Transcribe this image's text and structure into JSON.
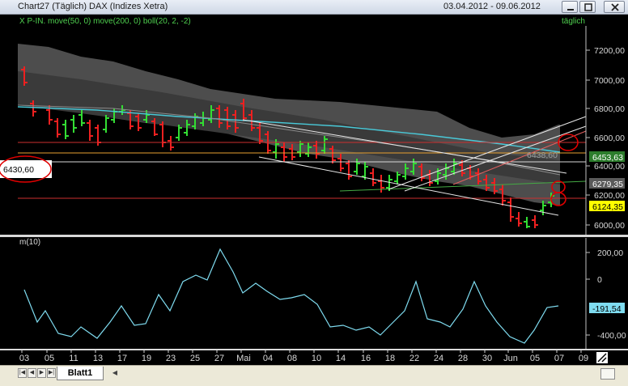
{
  "window": {
    "title": "Chart27 (Täglich)  DAX (Indizes Xetra)",
    "date_range": "03.04.2012 - 09.06.2012"
  },
  "indicator_line": "X P-IN. move(50, 0) move(200, 0) boll(20, 2, -2)",
  "period_label": "täglich",
  "lower_panel_label": "m(10)",
  "price_axis": [
    "7200,00",
    "7000,00",
    "6800,00",
    "6600,00",
    "6400,00",
    "6200,00",
    "6000,00"
  ],
  "price_badges": {
    "close": "6453,63",
    "ma": "6279,35",
    "low": "6124,35",
    "line_label": "6438,60",
    "left_marker": "6430,60"
  },
  "momentum_axis": [
    "200,00",
    "0",
    "-400,00"
  ],
  "momentum_badge": "-191,54",
  "date_axis": [
    "03",
    "05",
    "11",
    "13",
    "17",
    "19",
    "23",
    "25",
    "27",
    "Mai",
    "04",
    "08",
    "10",
    "14",
    "16",
    "18",
    "22",
    "24",
    "28",
    "30",
    "Jun",
    "05",
    "07",
    "09"
  ],
  "sheet": {
    "tab_label": "Blatt1"
  },
  "colors": {
    "background": "#000000",
    "up_bar": "#33dd33",
    "down_bar": "#ee2020",
    "momentum_line": "#7fdcf0",
    "cyan_ma": "#49c9d8",
    "band_fill": "#4d4d4d",
    "annotation": "#e00000",
    "highlight_badge": "#ffff00"
  },
  "icons": [
    "minimize-icon",
    "maximize-icon",
    "close-icon",
    "nav-first-icon",
    "nav-prev-icon",
    "nav-next-icon",
    "nav-last-icon",
    "scroll-left-icon"
  ]
}
